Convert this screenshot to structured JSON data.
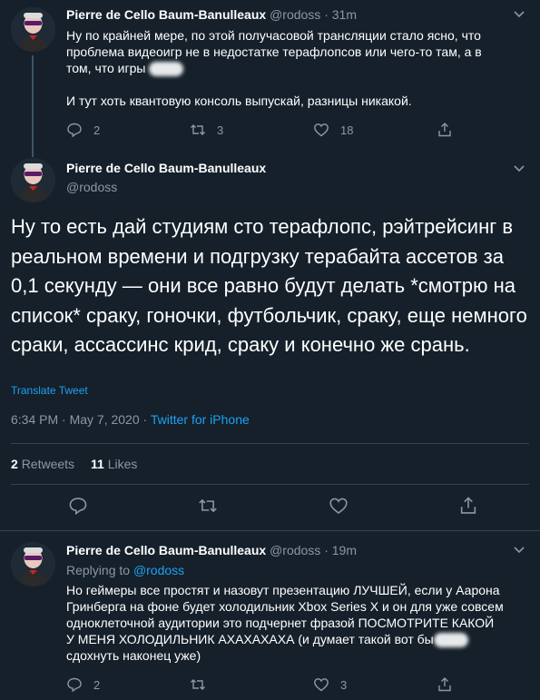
{
  "tweet1": {
    "name": "Pierre de Cello Baum-Banulleaux",
    "handle": "@rodoss",
    "dot": "·",
    "time": "31m",
    "text_line1": "Ну по крайней мере, по этой получасовой трансляции стало ясно, что",
    "text_line2": "проблема видеоигр не в недостатке терафлопсов или чего-то там, а в",
    "text_line3": "том, что игры",
    "text_para2": "И тут хоть квантовую консоль выпускай, разницы никакой.",
    "replies": "2",
    "retweets": "3",
    "likes": "18"
  },
  "main": {
    "name": "Pierre de Cello Baum-Banulleaux",
    "handle": "@rodoss",
    "text": "Ну то есть дай студиям сто терафлопс, рэйтрейсинг в реальном времени и подгрузку терабайта ассетов за 0,1 секунду — они все равно будут делать *смотрю на список* сраку, гоночки, футбольчик, сраку, еще немного сраки, ассассинс крид, сраку и конечно же срань.",
    "translate": "Translate Tweet",
    "timestamp": "6:34 PM · May 7, 2020 · ",
    "source": "Twitter for iPhone",
    "retweet_count": "2",
    "retweet_label": "Retweets",
    "like_count": "11",
    "like_label": "Likes"
  },
  "tweet3": {
    "name": "Pierre de Cello Baum-Banulleaux",
    "handle": "@rodoss",
    "dot": "·",
    "time": "19m",
    "replying_label": "Replying to ",
    "replying_handle": "@rodoss",
    "text_line1": "Но геймеры все простят и назовут презентацию ЛУЧШЕЙ, если у Аарона",
    "text_line2": "Гринберга на фоне будет холодильник Xbox Series X и он для уже совсем",
    "text_line3": "одноклеточной аудитории это подчернет фразой ПОСМОТРИТЕ КАКОЙ",
    "text_line4": "У МЕНЯ ХОЛОДИЛЬНИК АХАХАХАХА (и думает такой вот бы",
    "text_line5": "сдохнуть наконец уже)",
    "replies": "2",
    "retweets": "",
    "likes": "3"
  },
  "colors": {
    "background": "#15202b",
    "text": "#ffffff",
    "secondary": "#8899a6",
    "accent": "#1da1f2",
    "divider": "#38444d"
  }
}
